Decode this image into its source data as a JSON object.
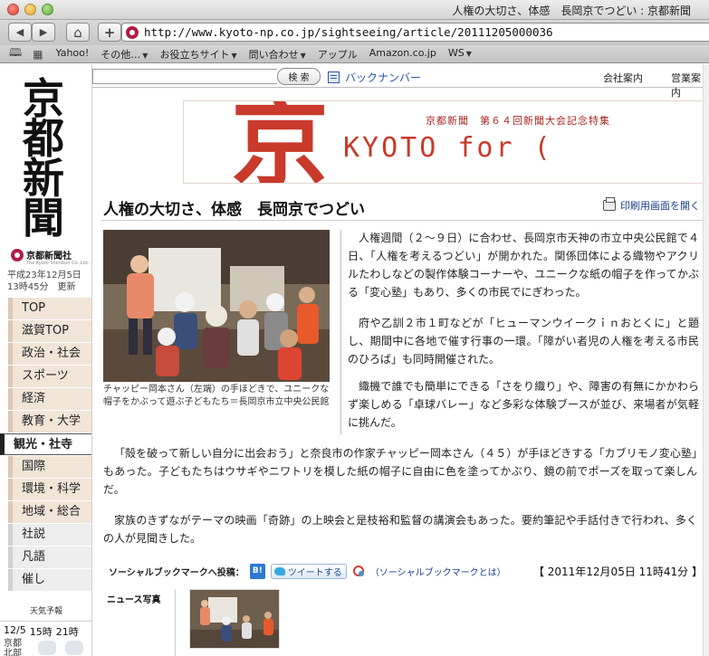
{
  "browser": {
    "window_title": "人権の大切さ、体感　長岡京でつどい : 京都新聞",
    "url": "http://www.kyoto-np.co.jp/sightseeing/article/20111205000036",
    "back_icon": "◀",
    "forward_icon": "▶",
    "home_icon": "⌂",
    "add_icon": "+",
    "bookmarks_icon": "🕮",
    "grid_icon": "▦",
    "bookmarks": [
      {
        "label": "Yahoo!",
        "menu": false
      },
      {
        "label": "その他…",
        "menu": true
      },
      {
        "label": "お役立ちサイト",
        "menu": true
      },
      {
        "label": "問い合わせ",
        "menu": true
      },
      {
        "label": "アップル",
        "menu": false
      },
      {
        "label": "Amazon.co.jp",
        "menu": false
      },
      {
        "label": "WS",
        "menu": true
      }
    ]
  },
  "topnav": {
    "search_button": "検 索",
    "backnumber": "バックナンバー",
    "company_info": "会社案内",
    "business_info": "営業案内"
  },
  "sidebar": {
    "logo": "京都新聞",
    "company_name": "京都新聞社",
    "company_name_en": "The Kyoto Shimbun Co.,Ltd.",
    "date": "平成23年12月5日",
    "time": "13時45分　更新",
    "nav": [
      {
        "label": "TOP",
        "style": "tan"
      },
      {
        "label": "滋賀TOP",
        "style": "tan"
      },
      {
        "label": "政治・社会",
        "style": "tan"
      },
      {
        "label": "スポーツ",
        "style": "tan"
      },
      {
        "label": "経済",
        "style": "tan"
      },
      {
        "label": "教育・大学",
        "style": "tan"
      },
      {
        "label": "観光・社寺",
        "style": "active"
      },
      {
        "label": "国際",
        "style": "tan"
      },
      {
        "label": "環境・科学",
        "style": "tan"
      },
      {
        "label": "地域・総合",
        "style": "tan"
      },
      {
        "label": "社説",
        "style": "gray"
      },
      {
        "label": "凡語",
        "style": "gray"
      },
      {
        "label": "催し",
        "style": "gray"
      }
    ],
    "weather": {
      "title": "天気予報",
      "times": [
        "12/5",
        "15時",
        "21時"
      ],
      "city": "京都",
      "city2": "北部"
    }
  },
  "banner": {
    "kanji": "京",
    "subtitle": "京都新聞　第６４回新聞大会記念特集",
    "main": "KYOTO for ("
  },
  "article": {
    "title": "人権の大切さ、体感　長岡京でつどい",
    "print_link": "印刷用画面を開く",
    "photo_caption": "チャッピー岡本さん（左端）の手ほどきで、ユニークな帽子をかぶって遊ぶ子どもたち＝長岡京市立中央公民館",
    "paragraphs": [
      "人権週間（２～９日）に合わせ、長岡京市天神の市立中央公民館で４日、「人権を考えるつどい」が開かれた。関係団体による織物やアクリルたわしなどの製作体験コーナーや、ユニークな紙の帽子を作ってかぶる「変心塾」もあり、多くの市民でにぎわった。",
      "府や乙訓２市１町などが「ヒューマンウイークｉｎおとくに」と題し、期間中に各地で催す行事の一環。「障がい者児の人権を考える市民のひろば」も同時開催された。",
      "織機で誰でも簡単にできる「さをり織り」や、障害の有無にかかわらず楽しめる「卓球バレー」など多彩な体験ブースが並び、来場者が気軽に挑んだ。",
      "「殻を破って新しい自分に出会おう」と奈良市の作家チャッピー岡本さん（４５）が手ほどきする「カブリモノ変心塾」もあった。子どもたちはウサギやニワトリを模した紙の帽子に自由に色を塗ってかぶり、鏡の前でポーズを取って楽しんだ。",
      "家族のきずながテーマの映画「奇跡」の上映会と是枝裕和監督の講演会もあった。要約筆記や手話付きで行われ、多くの人が見聞きした。"
    ],
    "social_label": "ソーシャルブックマークへ投稿：",
    "hatena_label": "B!",
    "tweet_label": "ツイートする",
    "sbm_link": "（ソーシャルブックマークとは）",
    "timestamp": "【 2011年12月05日 11時41分 】",
    "news_photo_label": "ニュース写真"
  },
  "colors": {
    "accent_red": "#c93a2b",
    "brand": "#b01c46",
    "link": "#1b3d8f",
    "nav_tan": "#f1e5d8"
  }
}
